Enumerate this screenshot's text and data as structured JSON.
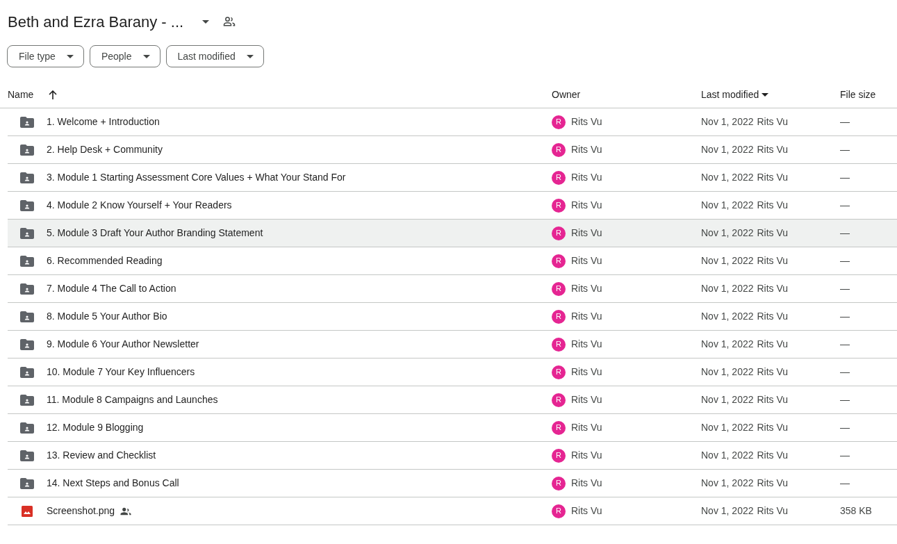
{
  "header": {
    "title": "Beth and Ezra Barany - ...",
    "shared": true
  },
  "filters": [
    {
      "label": "File type"
    },
    {
      "label": "People"
    },
    {
      "label": "Last modified"
    }
  ],
  "table": {
    "columns": [
      {
        "label": "Name",
        "sorted": true
      },
      {
        "label": "Owner"
      },
      {
        "label": "Last modified",
        "menu": true
      },
      {
        "label": "File size"
      }
    ],
    "rows": [
      {
        "kind": "shared-folder",
        "name": "1. Welcome + Introduction",
        "shared": false,
        "selected": false,
        "owner_initial": "R",
        "owner": "Rits Vu",
        "modified": "Nov 1, 2022",
        "modified_by": "Rits Vu",
        "size": "—"
      },
      {
        "kind": "shared-folder",
        "name": "2. Help Desk + Community",
        "shared": false,
        "selected": false,
        "owner_initial": "R",
        "owner": "Rits Vu",
        "modified": "Nov 1, 2022",
        "modified_by": "Rits Vu",
        "size": "—"
      },
      {
        "kind": "shared-folder",
        "name": "3. Module 1 Starting Assessment Core Values + What Your Stand For",
        "shared": false,
        "selected": false,
        "owner_initial": "R",
        "owner": "Rits Vu",
        "modified": "Nov 1, 2022",
        "modified_by": "Rits Vu",
        "size": "—"
      },
      {
        "kind": "shared-folder",
        "name": "4. Module 2 Know Yourself + Your Readers",
        "shared": false,
        "selected": false,
        "owner_initial": "R",
        "owner": "Rits Vu",
        "modified": "Nov 1, 2022",
        "modified_by": "Rits Vu",
        "size": "—"
      },
      {
        "kind": "shared-folder",
        "name": "5. Module 3 Draft Your Author Branding Statement",
        "shared": false,
        "selected": true,
        "owner_initial": "R",
        "owner": "Rits Vu",
        "modified": "Nov 1, 2022",
        "modified_by": "Rits Vu",
        "size": "—"
      },
      {
        "kind": "shared-folder",
        "name": "6. Recommended Reading",
        "shared": false,
        "selected": false,
        "owner_initial": "R",
        "owner": "Rits Vu",
        "modified": "Nov 1, 2022",
        "modified_by": "Rits Vu",
        "size": "—"
      },
      {
        "kind": "shared-folder",
        "name": "7. Module 4 The Call to Action",
        "shared": false,
        "selected": false,
        "owner_initial": "R",
        "owner": "Rits Vu",
        "modified": "Nov 1, 2022",
        "modified_by": "Rits Vu",
        "size": "—"
      },
      {
        "kind": "shared-folder",
        "name": "8. Module 5 Your Author Bio",
        "shared": false,
        "selected": false,
        "owner_initial": "R",
        "owner": "Rits Vu",
        "modified": "Nov 1, 2022",
        "modified_by": "Rits Vu",
        "size": "—"
      },
      {
        "kind": "shared-folder",
        "name": "9. Module 6 Your Author Newsletter",
        "shared": false,
        "selected": false,
        "owner_initial": "R",
        "owner": "Rits Vu",
        "modified": "Nov 1, 2022",
        "modified_by": "Rits Vu",
        "size": "—"
      },
      {
        "kind": "shared-folder",
        "name": "10. Module 7 Your Key Influencers",
        "shared": false,
        "selected": false,
        "owner_initial": "R",
        "owner": "Rits Vu",
        "modified": "Nov 1, 2022",
        "modified_by": "Rits Vu",
        "size": "—"
      },
      {
        "kind": "shared-folder",
        "name": "11. Module 8 Campaigns and Launches",
        "shared": false,
        "selected": false,
        "owner_initial": "R",
        "owner": "Rits Vu",
        "modified": "Nov 1, 2022",
        "modified_by": "Rits Vu",
        "size": "—"
      },
      {
        "kind": "shared-folder",
        "name": "12. Module 9 Blogging",
        "shared": false,
        "selected": false,
        "owner_initial": "R",
        "owner": "Rits Vu",
        "modified": "Nov 1, 2022",
        "modified_by": "Rits Vu",
        "size": "—"
      },
      {
        "kind": "shared-folder",
        "name": "13. Review and Checklist",
        "shared": false,
        "selected": false,
        "owner_initial": "R",
        "owner": "Rits Vu",
        "modified": "Nov 1, 2022",
        "modified_by": "Rits Vu",
        "size": "—"
      },
      {
        "kind": "shared-folder",
        "name": "14. Next Steps and Bonus Call",
        "shared": false,
        "selected": false,
        "owner_initial": "R",
        "owner": "Rits Vu",
        "modified": "Nov 1, 2022",
        "modified_by": "Rits Vu",
        "size": "—"
      },
      {
        "kind": "image",
        "name": "Screenshot.png",
        "shared": true,
        "selected": false,
        "owner_initial": "R",
        "owner": "Rits Vu",
        "modified": "Nov 1, 2022",
        "modified_by": "Rits Vu",
        "size": "358 KB"
      }
    ]
  }
}
